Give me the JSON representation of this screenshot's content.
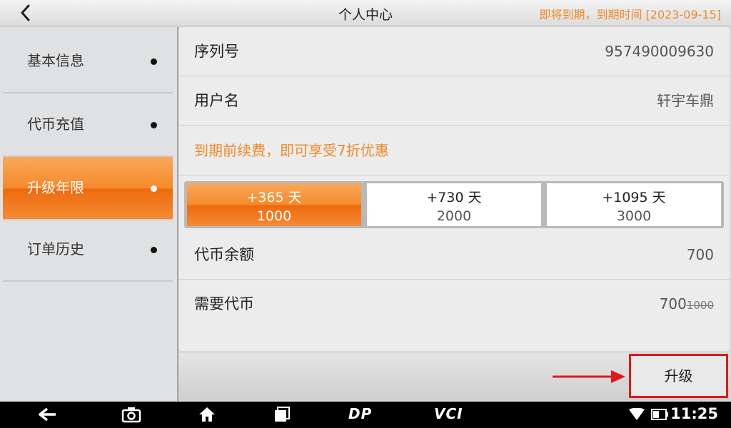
{
  "header": {
    "title": "个人中心",
    "expire_notice": "即将到期，到期时间 [2023-09-15]"
  },
  "sidebar": {
    "items": [
      {
        "label": "基本信息"
      },
      {
        "label": "代币充值"
      },
      {
        "label": "升级年限",
        "active": true
      },
      {
        "label": "订单历史"
      }
    ]
  },
  "main": {
    "serial": {
      "label": "序列号",
      "value": "957490009630"
    },
    "username": {
      "label": "用户名",
      "value": "轩宇车鼎"
    },
    "promo": "到期前续费，即可享受7折优惠",
    "options": [
      {
        "days": "+365 天",
        "price": "1000",
        "selected": true
      },
      {
        "days": "+730 天",
        "price": "2000"
      },
      {
        "days": "+1095 天",
        "price": "3000"
      }
    ],
    "balance": {
      "label": "代币余额",
      "value": "700"
    },
    "required": {
      "label": "需要代币",
      "value": "700",
      "original": "1000"
    }
  },
  "action": {
    "upgrade_label": "升级"
  },
  "navbar": {
    "dp_label": "DP",
    "vci_label": "VCI",
    "time": "11:25"
  },
  "colors": {
    "accent": "#f58a2a",
    "highlight_border": "#e01818"
  }
}
